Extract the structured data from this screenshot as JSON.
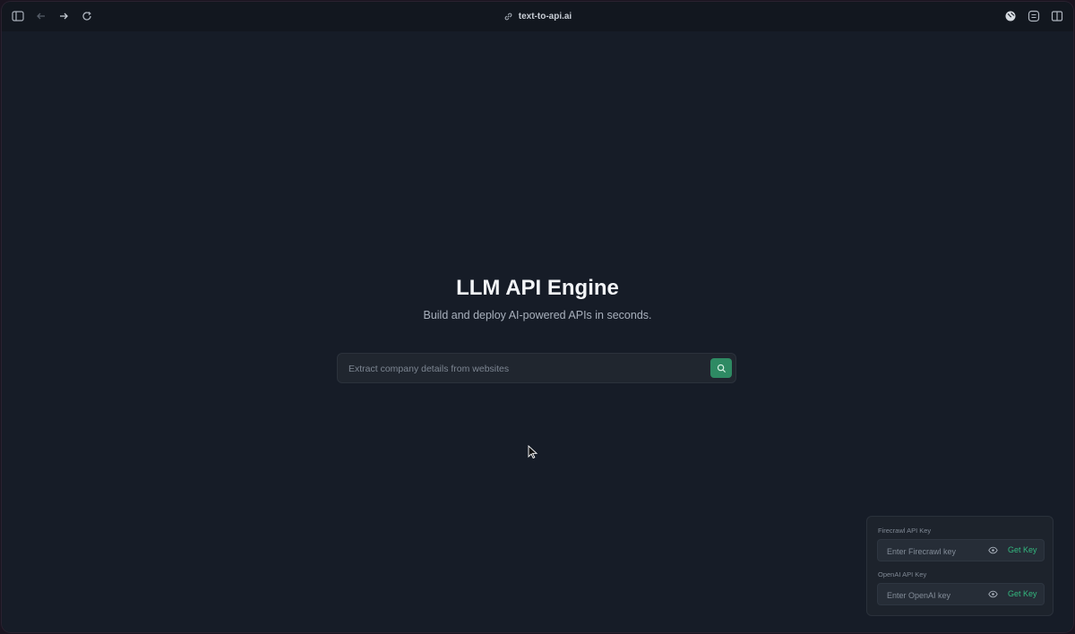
{
  "browser": {
    "url": "text-to-api.ai",
    "icons": {
      "sidebar": "sidebar-icon",
      "back": "arrow-left-icon",
      "forward": "arrow-right-icon",
      "reload": "reload-icon",
      "link": "link-icon",
      "extension1": "globe-icon",
      "extension2": "reader-icon",
      "split": "split-view-icon"
    }
  },
  "hero": {
    "title": "LLM API Engine",
    "subtitle": "Build and deploy AI-powered APIs in seconds."
  },
  "search": {
    "placeholder": "Extract company details from websites",
    "value": "",
    "button_icon": "search-icon"
  },
  "api_keys": {
    "firecrawl": {
      "label": "Firecrawl API Key",
      "placeholder": "Enter Firecrawl key",
      "value": "",
      "link": "Get Key"
    },
    "openai": {
      "label": "OpenAI API Key",
      "placeholder": "Enter OpenAI key",
      "value": "",
      "link": "Get Key"
    }
  },
  "colors": {
    "background": "#161c27",
    "accent": "#2e8a63",
    "link": "#33b87f",
    "text": "#f2f4f7"
  }
}
